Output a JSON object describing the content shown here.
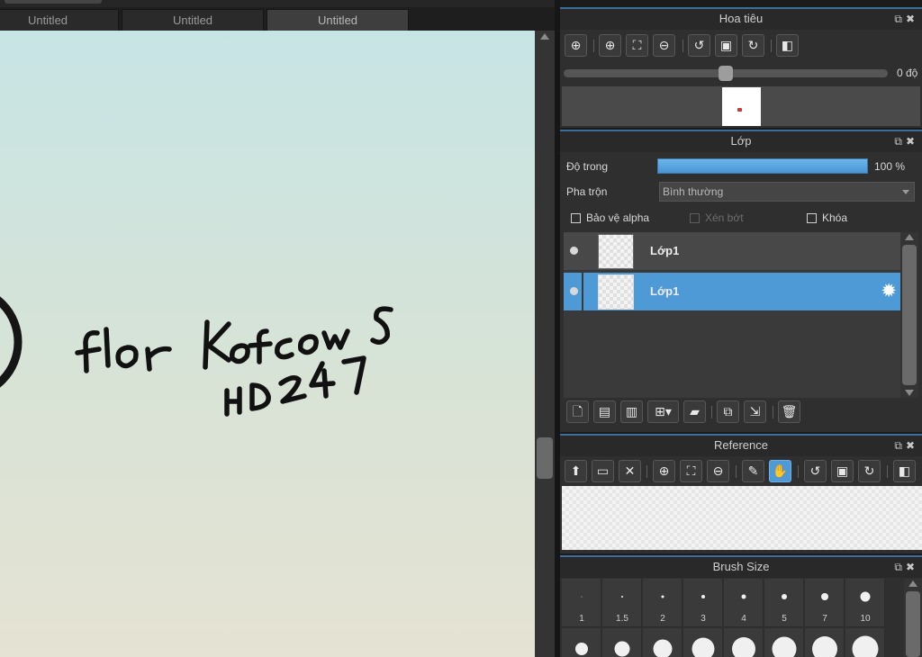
{
  "tabs": [
    {
      "label": "Untitled",
      "active": false
    },
    {
      "label": "Untitled",
      "active": false
    },
    {
      "label": "Untitled",
      "active": true
    }
  ],
  "canvas": {
    "handwriting_line1": "florKofcow S",
    "handwriting_line2": "HD247"
  },
  "navigator": {
    "title": "Hoa tiêu",
    "tools": [
      "zoom-actual-icon",
      "zoom-in-icon",
      "fit-window-icon",
      "zoom-out-icon",
      "rotate-left-icon",
      "reset-rotation-icon",
      "rotate-right-icon",
      "flip-horizontal-icon"
    ],
    "angle_label": "0 độ",
    "rotation_degrees": 0
  },
  "layers": {
    "title": "Lớp",
    "opacity_label": "Độ trong",
    "opacity_value": "100 %",
    "opacity_percent": 100,
    "blend_label": "Pha trộn",
    "blend_value": "Bình thường",
    "protect_alpha": "Bảo vệ alpha",
    "clipping": "Xén bớt",
    "lock": "Khóa",
    "items": [
      {
        "name": "Lớp1",
        "selected": false
      },
      {
        "name": "Lớp1",
        "selected": true
      }
    ],
    "bottom_tools": [
      "new-layer-icon",
      "new-halftone-layer-icon",
      "new-1bit-layer-icon",
      "add-layer-menu-icon",
      "folder-icon",
      "duplicate-layer-icon",
      "merge-down-icon",
      "delete-layer-icon"
    ]
  },
  "reference": {
    "title": "Reference",
    "tools": [
      "upload-icon",
      "open-folder-icon",
      "close-icon",
      "zoom-in-icon",
      "fit-window-icon",
      "zoom-out-icon",
      "eyedropper-icon",
      "hand-icon",
      "rotate-left-icon",
      "reset-rotation-icon",
      "rotate-right-icon",
      "flip-horizontal-icon"
    ]
  },
  "brush_size": {
    "title": "Brush Size",
    "sizes": [
      "1",
      "1.5",
      "2",
      "3",
      "4",
      "5",
      "7",
      "10"
    ]
  },
  "colors": {
    "accent": "#4e9ad6",
    "panel_bg": "#2f2f2f",
    "title_bg": "#292929"
  }
}
